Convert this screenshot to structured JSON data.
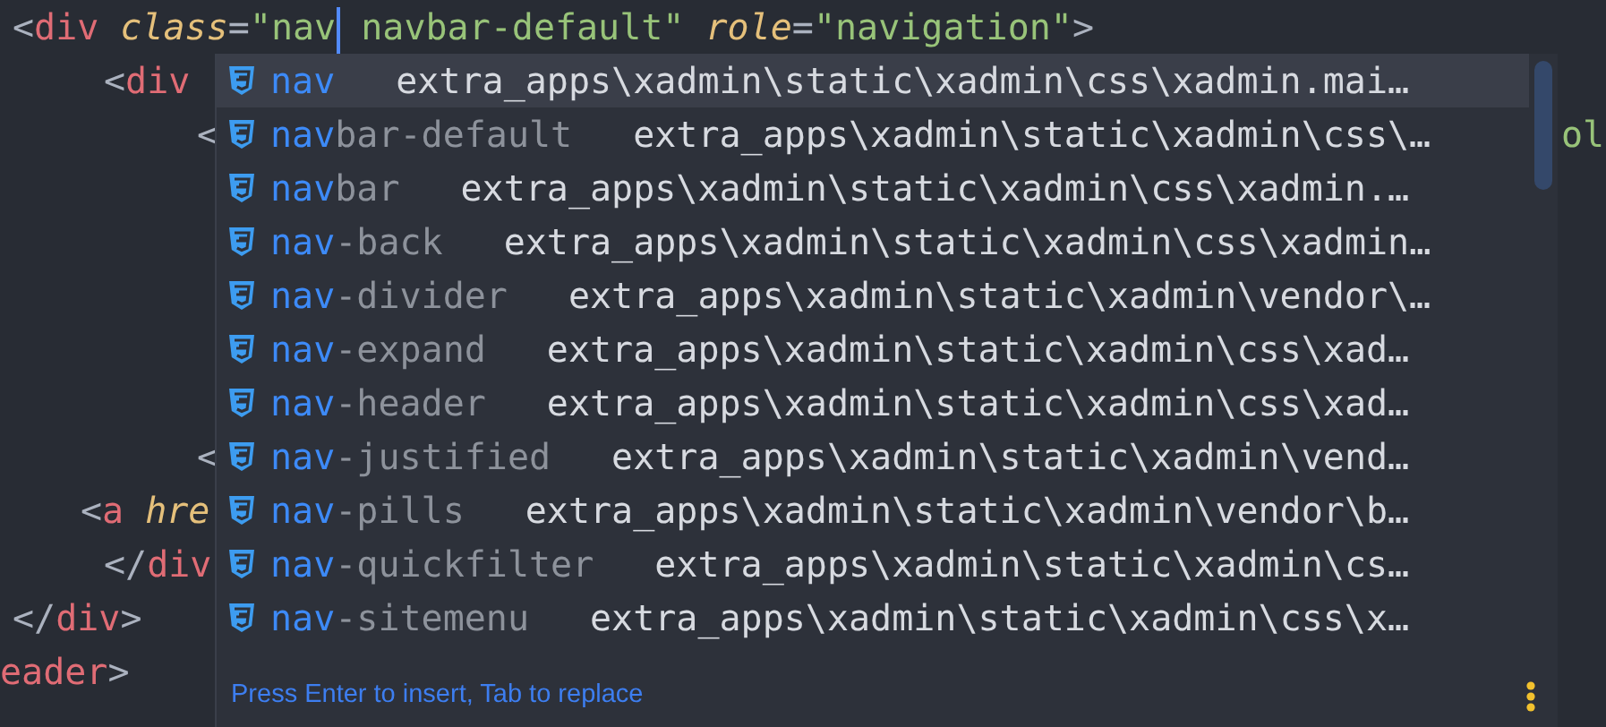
{
  "editor": {
    "lines": [
      {
        "segments": [
          {
            "kind": "bracket",
            "text": "<"
          },
          {
            "kind": "tag",
            "text": "div"
          },
          {
            "kind": "attr",
            "text": "class"
          },
          {
            "kind": "bracket",
            "text": "="
          },
          {
            "kind": "string",
            "text": "\"nav"
          },
          {
            "kind": "cursor"
          },
          {
            "kind": "string",
            "text": "navbar-default\""
          },
          {
            "kind": "attr",
            "text": "role"
          },
          {
            "kind": "bracket",
            "text": "="
          },
          {
            "kind": "string",
            "text": "\"navigation\""
          },
          {
            "kind": "bracket",
            "text": ">"
          }
        ]
      },
      {
        "segments": [
          {
            "kind": "bracket",
            "text": "<"
          },
          {
            "kind": "tag",
            "text": "div"
          }
        ]
      },
      {
        "segments": [
          {
            "kind": "bracket",
            "text": "<"
          },
          {
            "kind": "tail",
            "text": "ol"
          }
        ]
      },
      {
        "segments": [
          {
            "kind": "bracket",
            "text": "<"
          }
        ]
      },
      {
        "segments": [
          {
            "kind": "bracket",
            "text": "<"
          },
          {
            "kind": "tag",
            "text": "a"
          },
          {
            "kind": "attr",
            "text": "hre"
          }
        ]
      },
      {
        "segments": [
          {
            "kind": "bracket",
            "text": "</"
          },
          {
            "kind": "tag",
            "text": "div"
          }
        ]
      },
      {
        "segments": [
          {
            "kind": "bracket",
            "text": "</"
          },
          {
            "kind": "tag",
            "text": "div"
          },
          {
            "kind": "bracket",
            "text": ">"
          }
        ]
      },
      {
        "segments": [
          {
            "kind": "tag",
            "text": "eader"
          },
          {
            "kind": "bracket",
            "text": ">"
          }
        ]
      }
    ]
  },
  "completion": {
    "items": [
      {
        "match": "nav",
        "path": "extra_apps\\xadmin\\static\\xadmin\\css\\xadmin.mai…",
        "selected": true
      },
      {
        "match": "nav",
        "rest": "bar-default",
        "path": "extra_apps\\xadmin\\static\\xadmin\\css\\…",
        "selected": false
      },
      {
        "match": "nav",
        "rest": "bar",
        "path": "extra_apps\\xadmin\\static\\xadmin\\css\\xadmin.…",
        "selected": false
      },
      {
        "match": "nav",
        "rest": "-back",
        "path": "extra_apps\\xadmin\\static\\xadmin\\css\\xadmin…",
        "selected": false
      },
      {
        "match": "nav",
        "rest": "-divider",
        "path": "extra_apps\\xadmin\\static\\xadmin\\vendor\\…",
        "selected": false
      },
      {
        "match": "nav",
        "rest": "-expand",
        "path": "extra_apps\\xadmin\\static\\xadmin\\css\\xad…",
        "selected": false
      },
      {
        "match": "nav",
        "rest": "-header",
        "path": "extra_apps\\xadmin\\static\\xadmin\\css\\xad…",
        "selected": false
      },
      {
        "match": "nav",
        "rest": "-justified",
        "path": "extra_apps\\xadmin\\static\\xadmin\\vend…",
        "selected": false
      },
      {
        "match": "nav",
        "rest": "-pills",
        "path": "extra_apps\\xadmin\\static\\xadmin\\vendor\\b…",
        "selected": false
      },
      {
        "match": "nav",
        "rest": "-quickfilter",
        "path": "extra_apps\\xadmin\\static\\xadmin\\cs…",
        "selected": false
      },
      {
        "match": "nav",
        "rest": "-sitemenu",
        "path": "extra_apps\\xadmin\\static\\xadmin\\css\\x…",
        "selected": false
      }
    ],
    "hint": "Press Enter to insert, Tab to replace"
  }
}
